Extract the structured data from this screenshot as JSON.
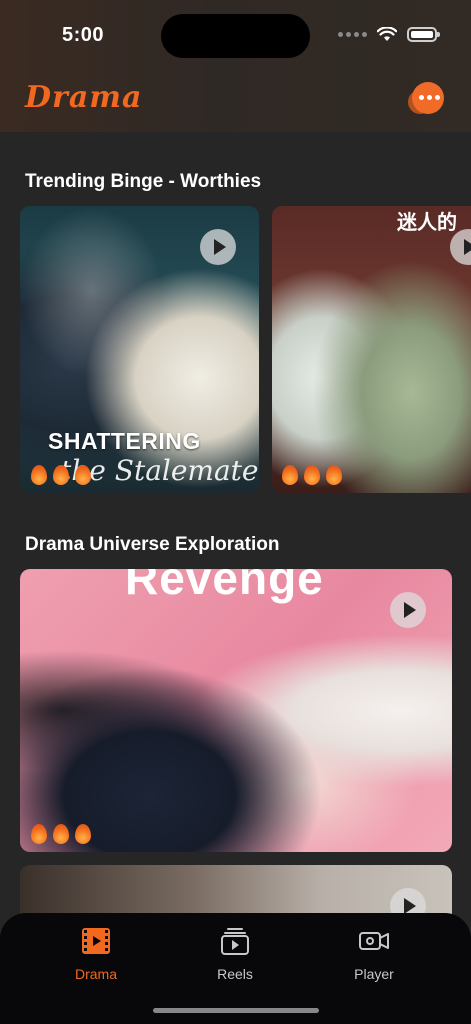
{
  "status_bar": {
    "time": "5:00"
  },
  "header": {
    "brand": "Drama"
  },
  "sections": [
    {
      "title": "Trending Binge - Worthies",
      "cards": [
        {
          "title_line1": "SHATTERING",
          "title_line2": "the Stalemate"
        },
        {
          "overlay_text": "迷人的"
        }
      ]
    },
    {
      "title": "Drama Universe Exploration",
      "cards": [
        {
          "overlay_text": "Revenge"
        }
      ]
    }
  ],
  "tabs": [
    {
      "label": "Drama",
      "icon": "film-icon",
      "active": true
    },
    {
      "label": "Reels",
      "icon": "reels-icon",
      "active": false
    },
    {
      "label": "Player",
      "icon": "video-camera-icon",
      "active": false
    }
  ],
  "colors": {
    "accent": "#f2681f",
    "background": "#262626",
    "tabbar": "#08080a",
    "inactive_tab": "#c8c8c8"
  }
}
